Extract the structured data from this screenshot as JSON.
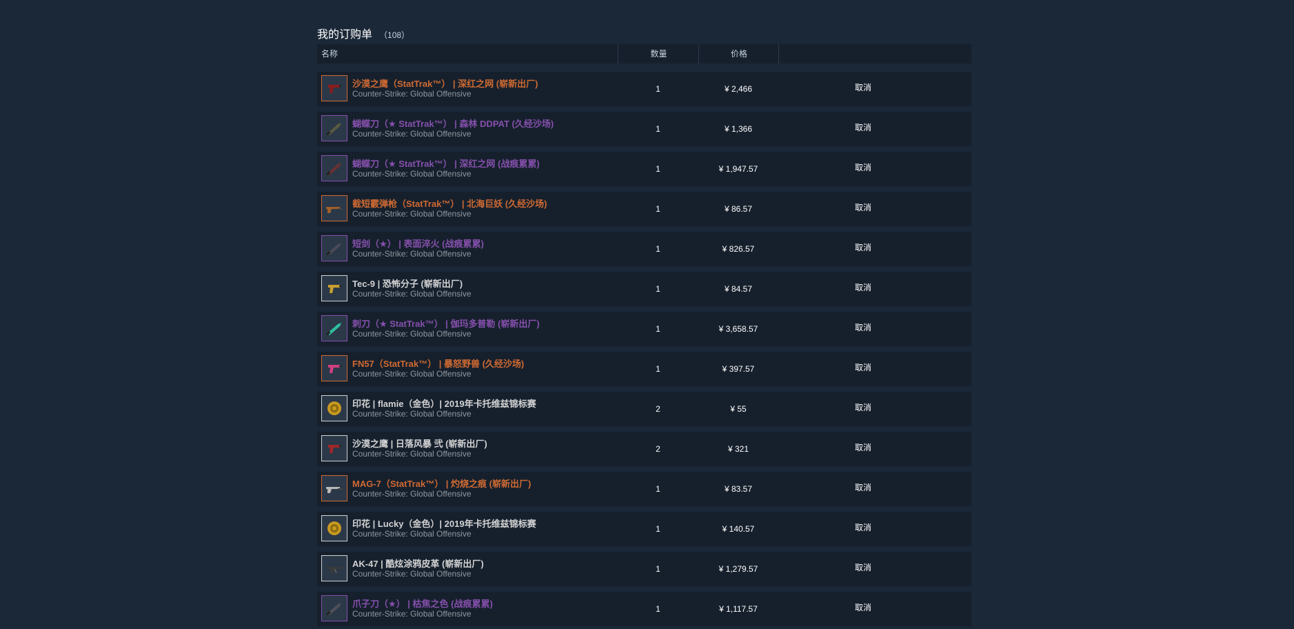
{
  "page": {
    "title": "我的订购单",
    "count": "（108）"
  },
  "columns": {
    "name": "名称",
    "quantity": "数量",
    "price": "价格"
  },
  "colors": {
    "stattrak": "#cf6a32",
    "rare": "#8650ac",
    "normal": "#d2d2d2",
    "game": "#8f98a0",
    "background": "#1b2838",
    "row": "#16202d"
  },
  "orders": [
    {
      "name": "沙漠之鹰（StatTrak™） | 深红之网 (崭新出厂)",
      "game": "Counter-Strike: Global Offensive",
      "quantity": "1",
      "price": "¥ 2,466",
      "cancel": "取消",
      "name_color": "#cf6a32",
      "border_color": "#cf6a32",
      "icon": "pistol-icon",
      "item_color": "#8a1c1c"
    },
    {
      "name": "蝴蝶刀（★ StatTrak™） | 森林 DDPAT (久经沙场)",
      "game": "Counter-Strike: Global Offensive",
      "quantity": "1",
      "price": "¥ 1,366",
      "cancel": "取消",
      "name_color": "#8650ac",
      "border_color": "#8650ac",
      "icon": "knife-icon",
      "item_color": "#5a5a40"
    },
    {
      "name": "蝴蝶刀（★ StatTrak™） | 深红之网 (战痕累累)",
      "game": "Counter-Strike: Global Offensive",
      "quantity": "1",
      "price": "¥ 1,947.57",
      "cancel": "取消",
      "name_color": "#8650ac",
      "border_color": "#8650ac",
      "icon": "knife-icon",
      "item_color": "#6a3030"
    },
    {
      "name": "截短霰弹枪（StatTrak™） | 北海巨妖 (久经沙场)",
      "game": "Counter-Strike: Global Offensive",
      "quantity": "1",
      "price": "¥ 86.57",
      "cancel": "取消",
      "name_color": "#cf6a32",
      "border_color": "#cf6a32",
      "icon": "shotgun-icon",
      "item_color": "#a0602a"
    },
    {
      "name": "短剑（★） | 表面淬火 (战痕累累)",
      "game": "Counter-Strike: Global Offensive",
      "quantity": "1",
      "price": "¥ 826.57",
      "cancel": "取消",
      "name_color": "#8650ac",
      "border_color": "#8650ac",
      "icon": "knife-icon",
      "item_color": "#4a4a58"
    },
    {
      "name": "Tec-9 | 恐怖分子 (崭新出厂)",
      "game": "Counter-Strike: Global Offensive",
      "quantity": "1",
      "price": "¥ 84.57",
      "cancel": "取消",
      "name_color": "#d2d2d2",
      "border_color": "#d2d2d2",
      "icon": "pistol-icon",
      "item_color": "#c8a030"
    },
    {
      "name": "刺刀（★ StatTrak™） | 伽玛多普勒 (崭新出厂)",
      "game": "Counter-Strike: Global Offensive",
      "quantity": "1",
      "price": "¥ 3,658.57",
      "cancel": "取消",
      "name_color": "#8650ac",
      "border_color": "#8650ac",
      "icon": "knife-icon",
      "item_color": "#30c0a0"
    },
    {
      "name": "FN57（StatTrak™） | 暴怒野兽 (久经沙场)",
      "game": "Counter-Strike: Global Offensive",
      "quantity": "1",
      "price": "¥ 397.57",
      "cancel": "取消",
      "name_color": "#cf6a32",
      "border_color": "#cf6a32",
      "icon": "pistol-icon",
      "item_color": "#d04080"
    },
    {
      "name": "印花 | flamie（金色）| 2019年卡托维兹锦标赛",
      "game": "Counter-Strike: Global Offensive",
      "quantity": "2",
      "price": "¥ 55",
      "cancel": "取消",
      "name_color": "#d2d2d2",
      "border_color": "#d2d2d2",
      "icon": "sticker-icon",
      "item_color": "#c89820"
    },
    {
      "name": "沙漠之鹰 | 日落风暴 弐 (崭新出厂)",
      "game": "Counter-Strike: Global Offensive",
      "quantity": "2",
      "price": "¥ 321",
      "cancel": "取消",
      "name_color": "#d2d2d2",
      "border_color": "#d2d2d2",
      "icon": "pistol-icon",
      "item_color": "#a02828"
    },
    {
      "name": "MAG-7（StatTrak™） | 灼烧之痕 (崭新出厂)",
      "game": "Counter-Strike: Global Offensive",
      "quantity": "1",
      "price": "¥ 83.57",
      "cancel": "取消",
      "name_color": "#cf6a32",
      "border_color": "#cf6a32",
      "icon": "shotgun-icon",
      "item_color": "#b8b8b8"
    },
    {
      "name": "印花 | Lucky（金色）| 2019年卡托维兹锦标赛",
      "game": "Counter-Strike: Global Offensive",
      "quantity": "1",
      "price": "¥ 140.57",
      "cancel": "取消",
      "name_color": "#d2d2d2",
      "border_color": "#d2d2d2",
      "icon": "sticker-icon",
      "item_color": "#c89820"
    },
    {
      "name": "AK-47 | 酷炫涂鸦皮革 (崭新出厂)",
      "game": "Counter-Strike: Global Offensive",
      "quantity": "1",
      "price": "¥ 1,279.57",
      "cancel": "取消",
      "name_color": "#d2d2d2",
      "border_color": "#d2d2d2",
      "icon": "rifle-icon",
      "item_color": "#3a3a3a"
    },
    {
      "name": "爪子刀（★） | 枯焦之色 (战痕累累)",
      "game": "Counter-Strike: Global Offensive",
      "quantity": "1",
      "price": "¥ 1,117.57",
      "cancel": "取消",
      "name_color": "#8650ac",
      "border_color": "#8650ac",
      "icon": "knife-icon",
      "item_color": "#505058"
    }
  ]
}
